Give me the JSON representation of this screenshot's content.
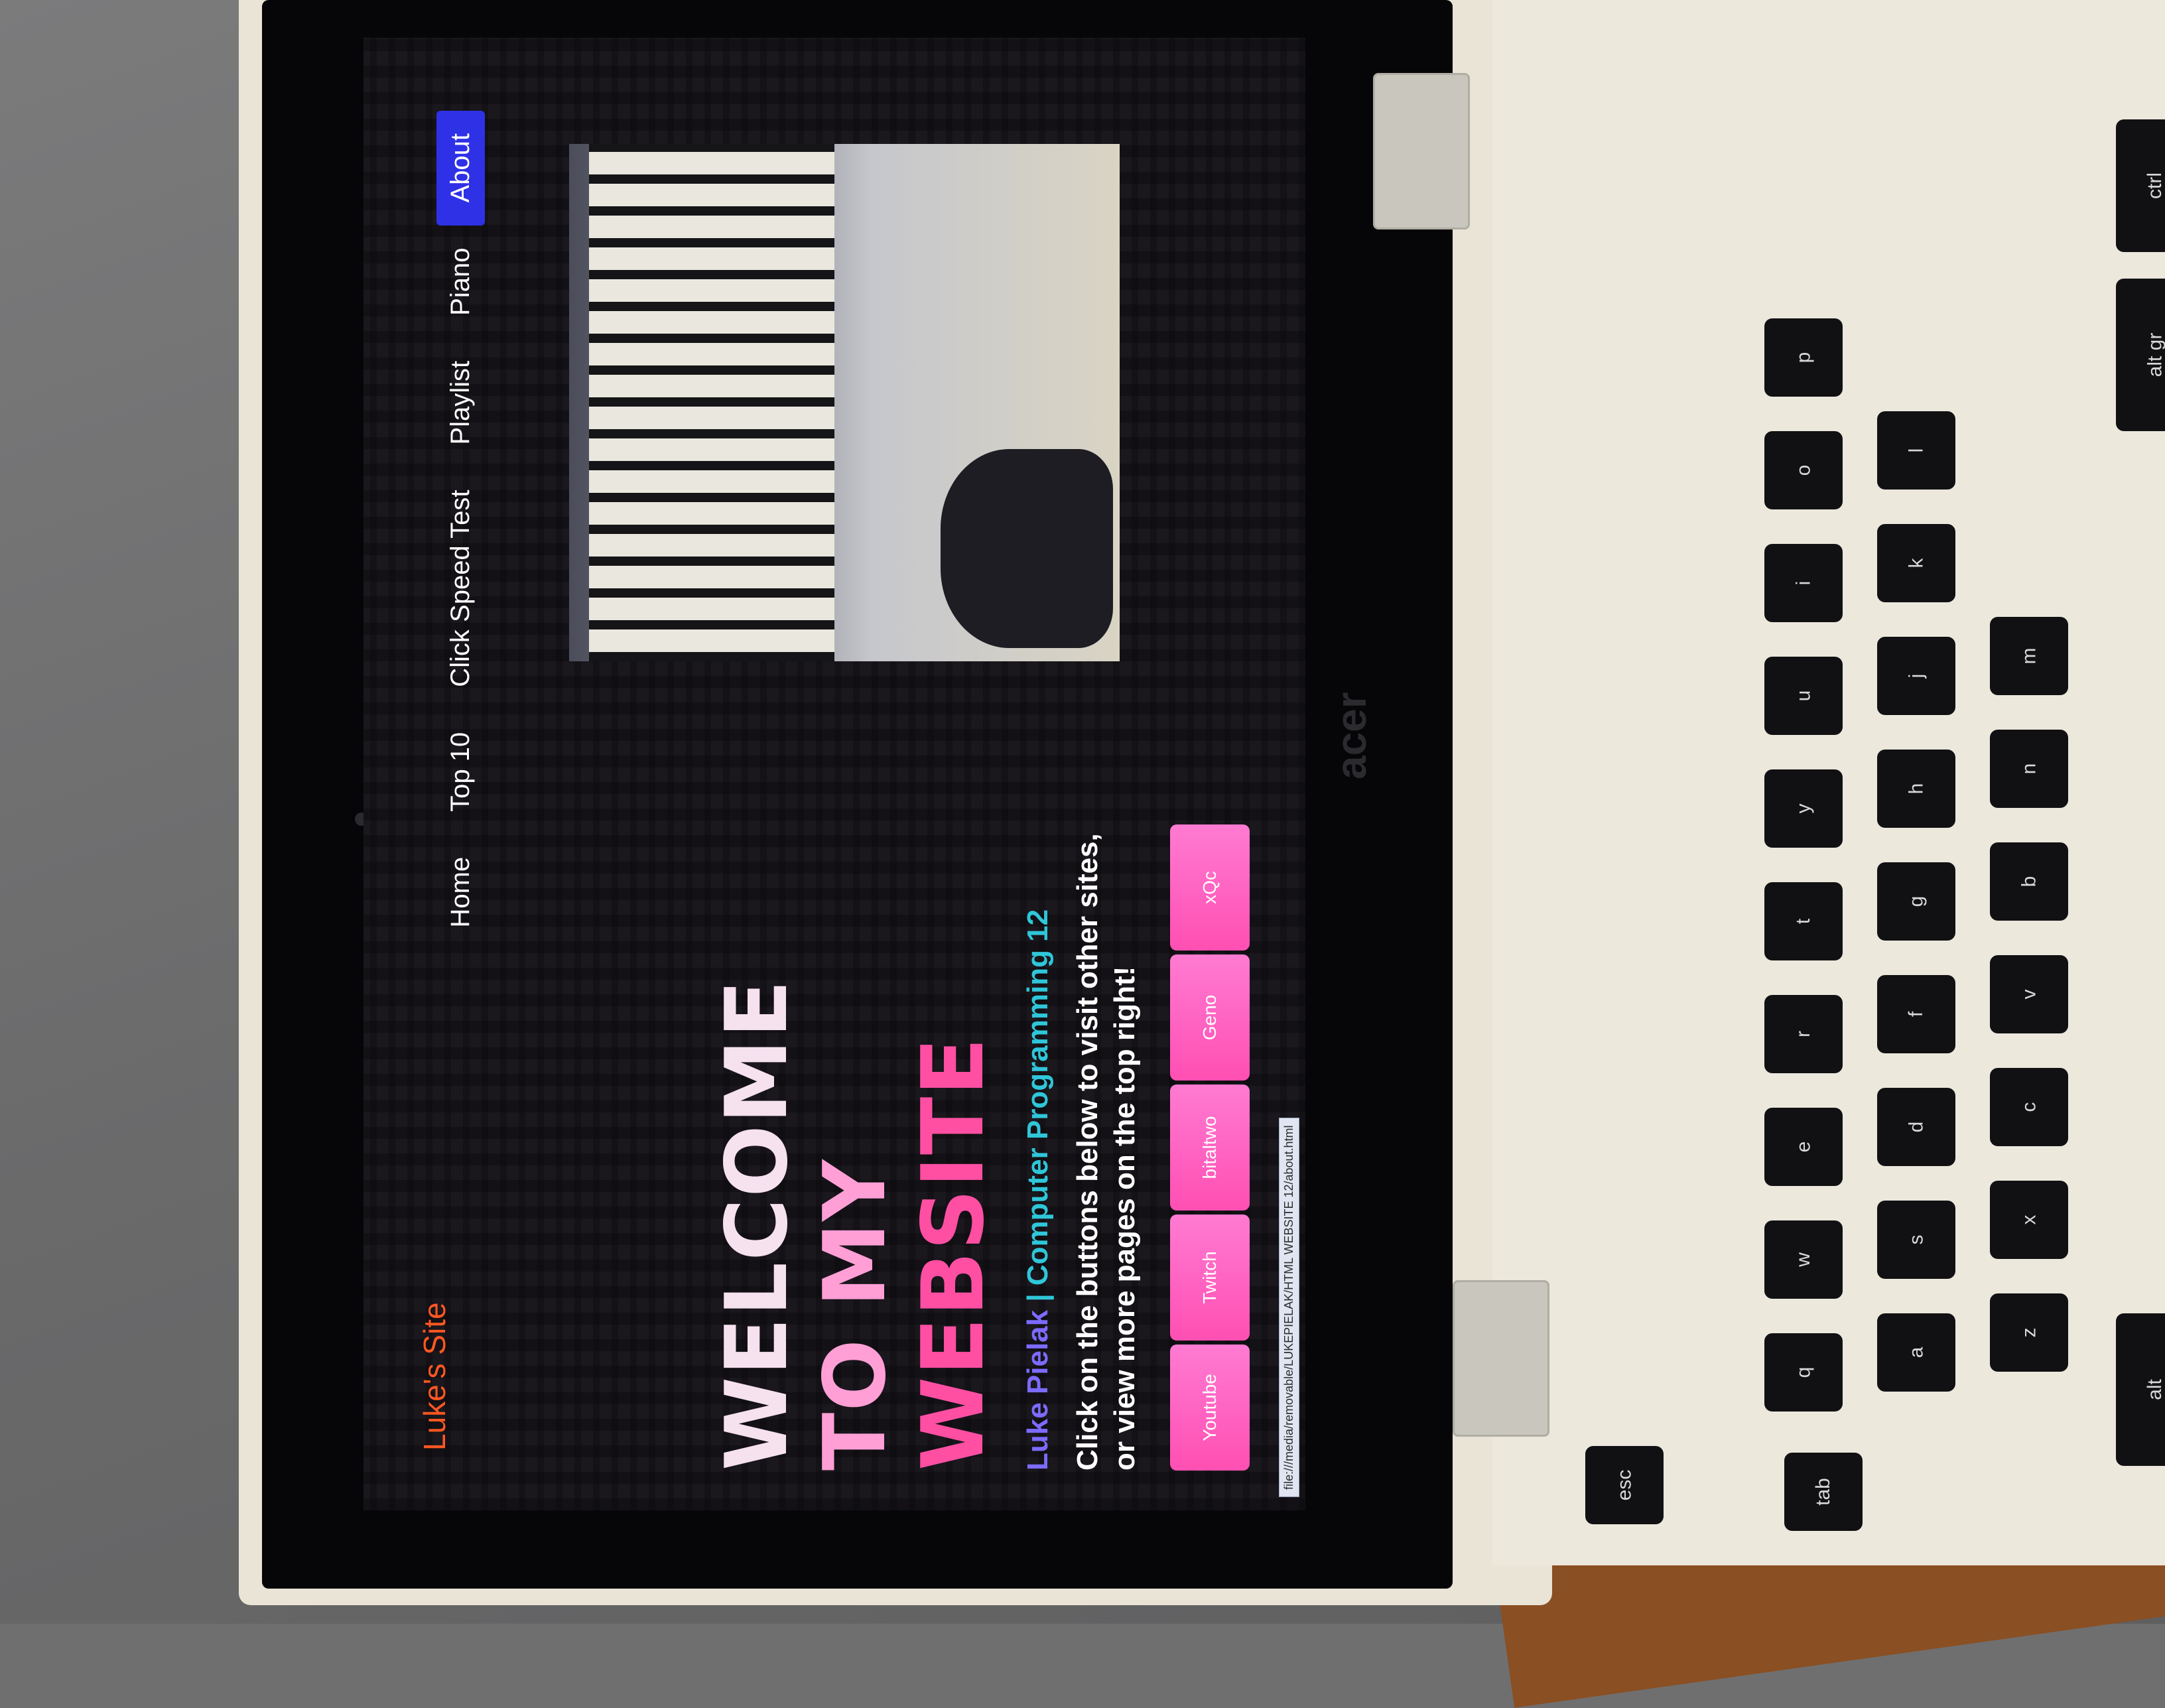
{
  "site": {
    "brand": "Luke's Site",
    "nav": [
      "Home",
      "Top 10",
      "Click Speed Test",
      "Playlist",
      "Piano",
      "About"
    ],
    "active_nav": "About"
  },
  "hero": {
    "line1": "WELCOME",
    "line2": "TO MY",
    "line3": "WEBSITE",
    "subtitle_name": "Luke Pielak",
    "subtitle_sep": " | ",
    "subtitle_course": "Computer Programming 12",
    "description": "Click on the buttons below to visit other sites, or view more pages on the top right!",
    "buttons": [
      "Youtube",
      "Twitch",
      "bitaltwo",
      "Geno",
      "xQc"
    ]
  },
  "status_url": "file:///media/removable/LUKEPIELAK/HTML WEBSITE 12/about.html",
  "laptop": {
    "brand_logo": "acer"
  },
  "keyboard": {
    "keys": [
      "esc",
      "tab",
      "alt",
      "alt gr",
      "ctrl",
      "q",
      "w",
      "e",
      "r",
      "t",
      "y",
      "u",
      "i",
      "o",
      "p",
      "a",
      "s",
      "d",
      "f",
      "g",
      "h",
      "j",
      "k",
      "l",
      "z",
      "x",
      "c",
      "v",
      "b",
      "n",
      "m"
    ]
  },
  "colors": {
    "brand": "#ff5722",
    "nav_active": "#2f31e6",
    "button_pink": "#ff4fb3"
  }
}
